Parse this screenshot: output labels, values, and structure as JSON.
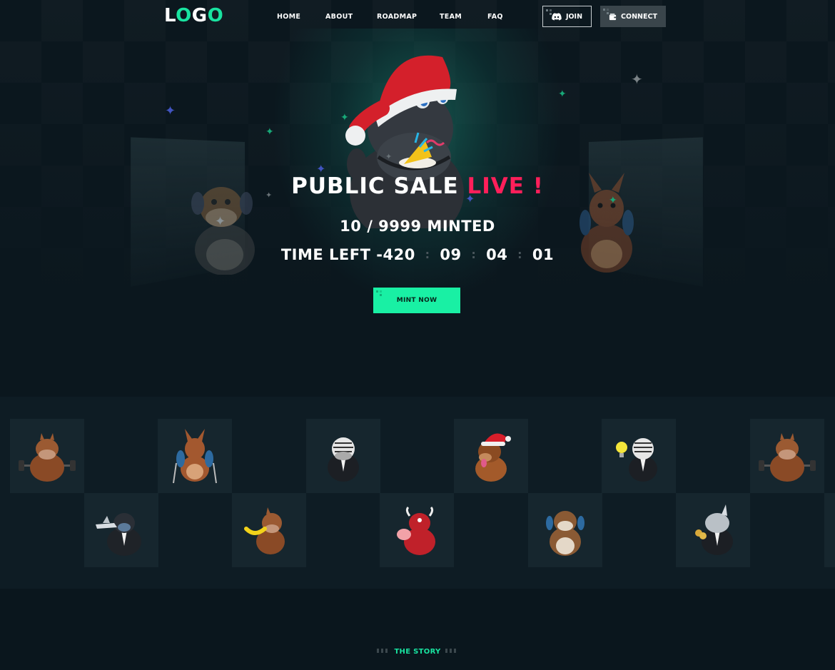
{
  "nav": {
    "logo": {
      "l": "L",
      "o": "O",
      "g": "G",
      "o2": "O"
    },
    "links": [
      "HOME",
      "ABOUT",
      "ROADMAP",
      "TEAM",
      "FAQ"
    ],
    "join_label": "JOIN",
    "connect_label": "CONNECT"
  },
  "hero": {
    "headline_main": "PUBLIC SALE",
    "headline_live": "LIVE",
    "headline_bang": "!",
    "minted": "10 / 9999 MINTED",
    "time_left_label": "TIME LEFT",
    "countdown": [
      "-420",
      "09",
      "04",
      "01"
    ],
    "countdown_sep": ":",
    "mint_button": "MINT NOW"
  },
  "gallery": {
    "row1": [
      "horse-weights",
      "kangaroo-hiker",
      "zebra-suit",
      "dog-santa",
      "zebra-lightbulb",
      "horse-weights"
    ],
    "row2": [
      "gorilla-plane",
      "horse-banana",
      "bull-pig",
      "bulldog-backpack",
      "rhino-coins"
    ]
  },
  "story": {
    "label": "THE STORY"
  },
  "colors": {
    "accent": "#19e3a0",
    "live": "#ff1f5a",
    "mint_button": "#19f0a4",
    "background": "#0b171e"
  }
}
